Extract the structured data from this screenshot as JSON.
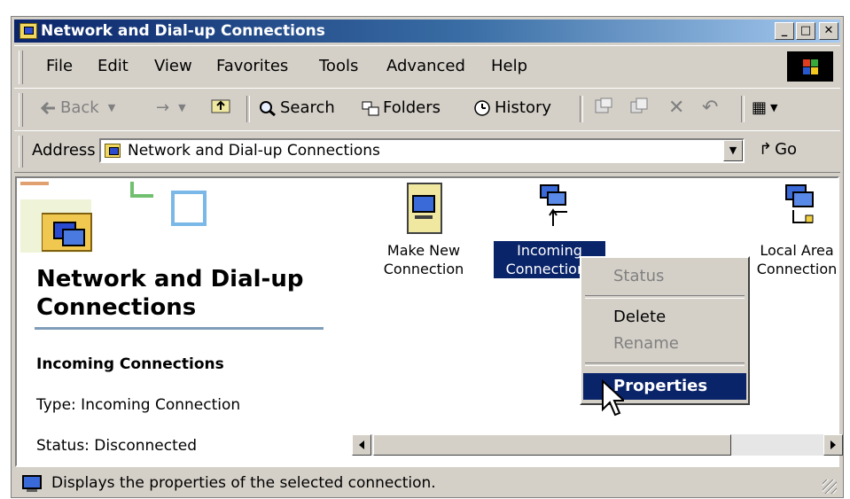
{
  "window": {
    "title": "Network and Dial-up Connections",
    "controls": {
      "minimize": "_",
      "maximize": "□",
      "close": "✕"
    }
  },
  "menu": [
    "File",
    "Edit",
    "View",
    "Favorites",
    "Tools",
    "Advanced",
    "Help"
  ],
  "toolbar": {
    "back": "Back",
    "forward_icon": "→",
    "search": "Search",
    "folders": "Folders",
    "history": "History",
    "delete_icon": "✕",
    "undo_icon": "↶",
    "views_icon": "▦"
  },
  "address": {
    "label": "Address",
    "value": "Network and Dial-up Connections",
    "go": "Go"
  },
  "panel": {
    "title": "Network and Dial-up Connections",
    "selected_name": "Incoming Connections",
    "type": "Type: Incoming Connection",
    "status": "Status: Disconnected"
  },
  "icons": [
    {
      "label": "Make New Connection",
      "icon": "make-new-connection-icon"
    },
    {
      "label": "Incoming Connections",
      "icon": "incoming-connections-icon",
      "selected": true
    },
    {
      "label": "Local Area Connection",
      "icon": "local-area-connection-icon"
    }
  ],
  "context_menu": {
    "status": "Status",
    "delete": "Delete",
    "rename": "Rename",
    "properties": "Properties"
  },
  "status_bar": {
    "text": "Displays the properties of the selected connection."
  },
  "colors": {
    "selection": "#0a246a",
    "face": "#d4d0c8",
    "disabled": "#808080"
  }
}
